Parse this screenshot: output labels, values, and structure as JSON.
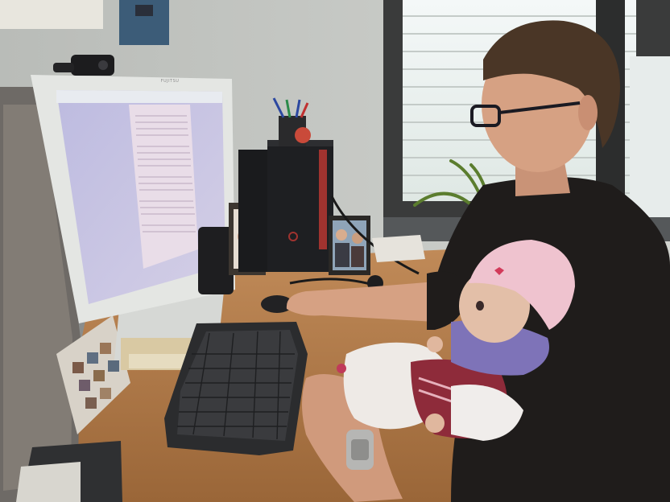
{
  "scene": {
    "kind": "photo",
    "monitor_brand": "FUJITSU",
    "colors": {
      "wall": "#c9ccc8",
      "desk": "#b07a4a",
      "monitor_bezel": "#e4e6e3",
      "screen": "#c7c4e0",
      "document_page": "#e9dde8",
      "window_light": "#f2f6f6",
      "shirt": "#1f1c1b",
      "skin": "#d6a183",
      "baby_hat": "#efc3cf",
      "blanket": "#eeeae6",
      "bib": "#7e73b8",
      "keyboard": "#2b2c2e",
      "tower": "#1e1f22",
      "tower_accent": "#a0332f"
    }
  }
}
